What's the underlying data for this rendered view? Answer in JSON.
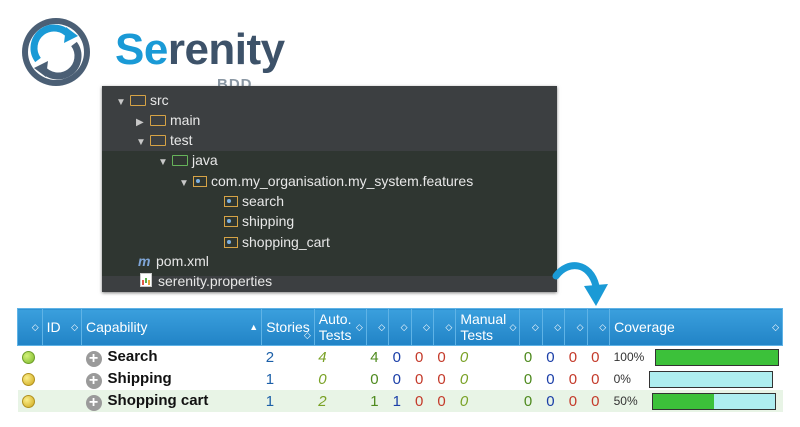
{
  "logo": {
    "name_prefix": "Se",
    "name_rest": "renity",
    "subtitle": "BDD"
  },
  "tree": [
    {
      "label": "src",
      "icon": "folder-icon",
      "expanded": true
    },
    {
      "label": "main",
      "icon": "folder-icon",
      "expanded": false
    },
    {
      "label": "test",
      "icon": "folder-icon",
      "expanded": true
    },
    {
      "label": "java",
      "icon": "source-folder-icon",
      "expanded": true
    },
    {
      "label": "com.my_organisation.my_system.features",
      "icon": "package-icon",
      "expanded": true
    },
    {
      "label": "search",
      "icon": "package-icon"
    },
    {
      "label": "shipping",
      "icon": "package-icon"
    },
    {
      "label": "shopping_cart",
      "icon": "package-icon"
    },
    {
      "label": "pom.xml",
      "icon": "maven-icon"
    },
    {
      "label": "serenity.properties",
      "icon": "properties-icon"
    }
  ],
  "table": {
    "headers": {
      "id": "ID",
      "capability": "Capability",
      "stories": "Stories",
      "auto_tests_1": "Auto.",
      "auto_tests_2": "Tests",
      "manual_tests_1": "Manual",
      "manual_tests_2": "Tests",
      "coverage": "Coverage"
    },
    "rows": [
      {
        "status": "green",
        "capability": "Search",
        "stories": "2",
        "auto": "4",
        "a_pass": "4",
        "a_skip": "0",
        "a_fail": "0",
        "a_err": "0",
        "manual": "0",
        "m_pass": "0",
        "m_skip": "0",
        "m_fail": "0",
        "m_err": "0",
        "coverage_label": "100%",
        "coverage": 1.0
      },
      {
        "status": "yellow",
        "capability": "Shipping",
        "stories": "1",
        "auto": "0",
        "a_pass": "0",
        "a_skip": "0",
        "a_fail": "0",
        "a_err": "0",
        "manual": "0",
        "m_pass": "0",
        "m_skip": "0",
        "m_fail": "0",
        "m_err": "0",
        "coverage_label": "0%",
        "coverage": 0.0
      },
      {
        "status": "yellow",
        "capability": "Shopping cart",
        "stories": "1",
        "auto": "2",
        "a_pass": "1",
        "a_skip": "1",
        "a_fail": "0",
        "a_err": "0",
        "manual": "0",
        "m_pass": "0",
        "m_skip": "0",
        "m_fail": "0",
        "m_err": "0",
        "coverage_label": "50%",
        "coverage": 0.5
      }
    ]
  },
  "colors": {
    "header_blue": "#2183c6",
    "pass_green": "#3cc13a",
    "remaining": "#aeeef0"
  }
}
